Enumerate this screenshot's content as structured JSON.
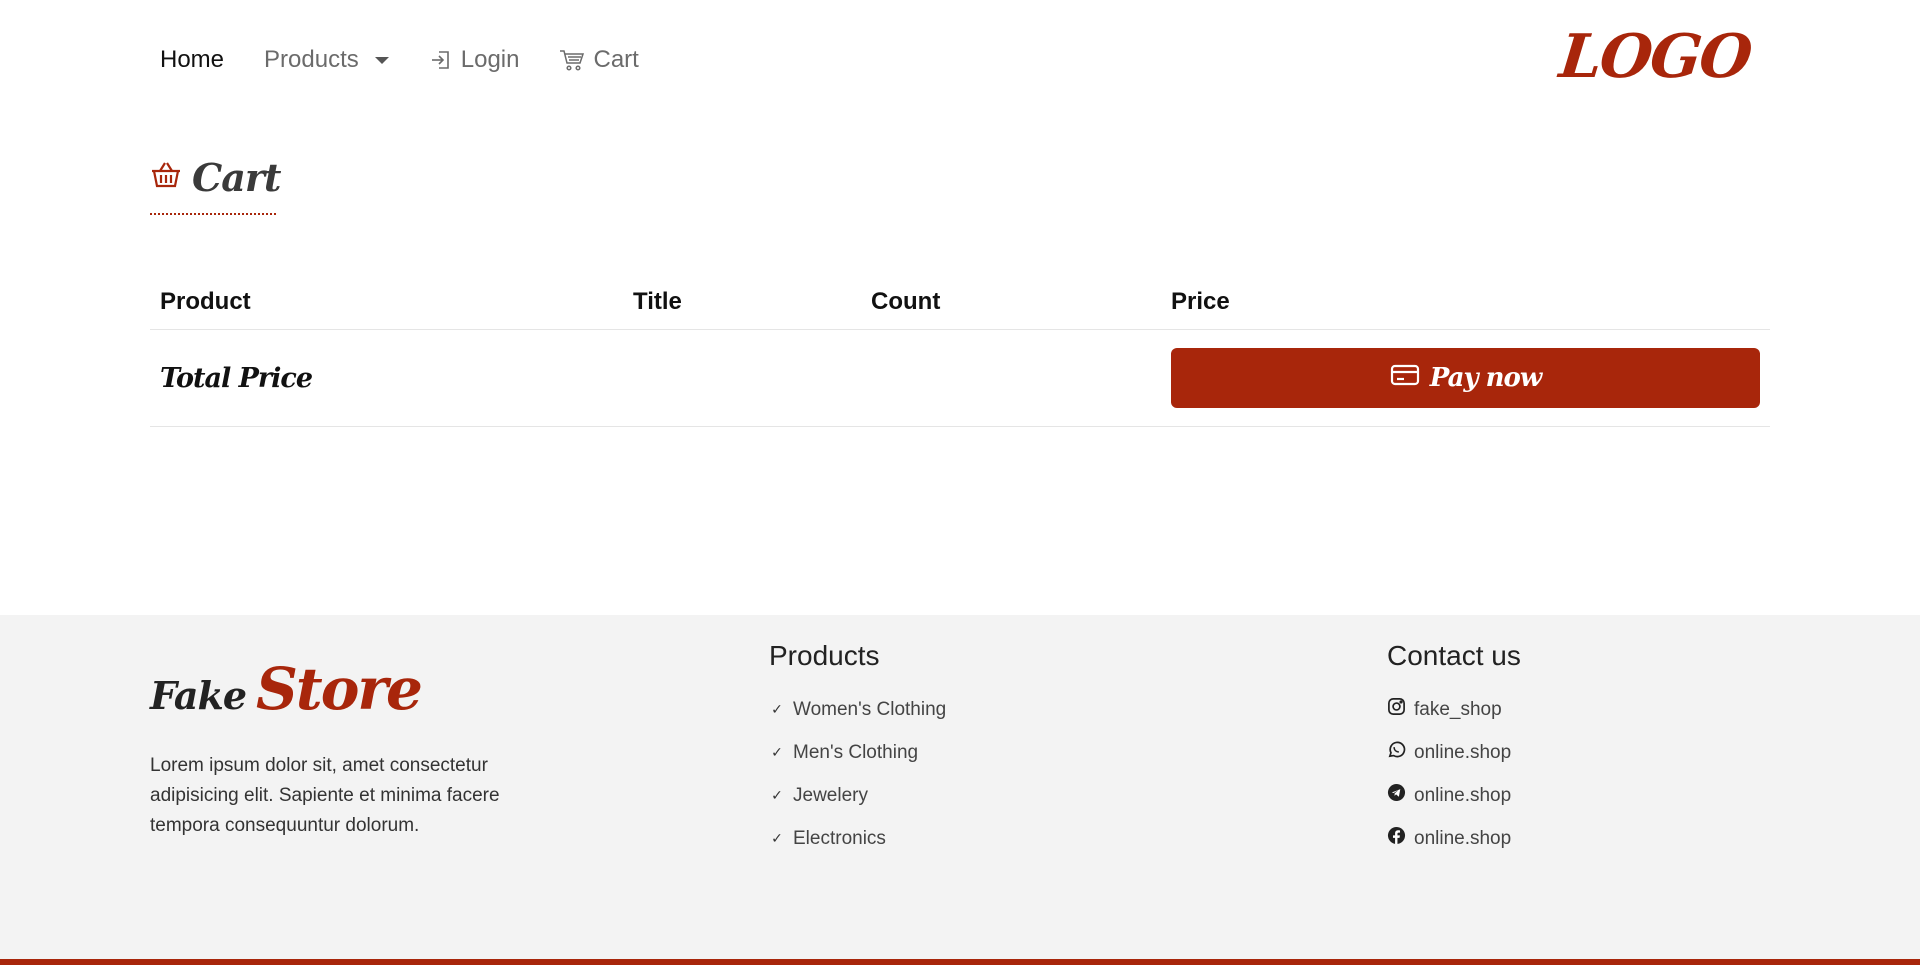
{
  "nav": {
    "home": "Home",
    "products": "Products",
    "login": "Login",
    "cart": "Cart",
    "logo": "LOGO"
  },
  "cart_heading": "Cart",
  "table": {
    "headers": [
      "Product",
      "Title",
      "Count",
      "Price"
    ],
    "total_label": "Total Price",
    "pay_button": "Pay now"
  },
  "footer": {
    "brand_fake": "Fake",
    "brand_store": "Store",
    "description": "Lorem ipsum dolor sit, amet consectetur adipisicing elit. Sapiente et minima facere tempora consequuntur dolorum.",
    "products_heading": "Products",
    "products": [
      "Women's Clothing",
      "Men's Clothing",
      "Jewelery",
      "Electronics"
    ],
    "contact_heading": "Contact us",
    "contacts": [
      {
        "icon": "instagram-icon",
        "text": "fake_shop"
      },
      {
        "icon": "whatsapp-icon",
        "text": "online.shop"
      },
      {
        "icon": "telegram-icon",
        "text": "online.shop"
      },
      {
        "icon": "facebook-icon",
        "text": "online.shop"
      }
    ]
  },
  "colors": {
    "accent": "#a8260b",
    "footer_bg": "#f3f3f3"
  }
}
